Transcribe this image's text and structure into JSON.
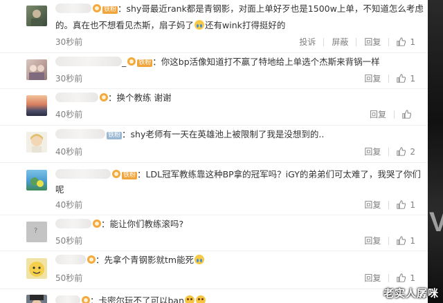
{
  "comments": [
    {
      "badge": "铁粉",
      "text_line1": "：shy哥最近rank都是青钢影，对面上单好歹也是1500w上单，不知道怎么考虑",
      "text_line2a": "的。真在也不想看见杰斯，扇子妈了",
      "text_line2b": "还有wink打得挺好的",
      "time": "30秒前",
      "report": "投诉",
      "block": "屏蔽",
      "reply": "回复",
      "likes": "1"
    },
    {
      "prefix": "_",
      "badge": "铁粉",
      "text": "：你这bp活像知道打不赢了特地给上单选个杰斯来背锅一样",
      "time": "30秒前",
      "reply": "回复",
      "likes": "1"
    },
    {
      "text": "：换个教练 谢谢",
      "time": "40秒前",
      "reply": "回复",
      "likes": ""
    },
    {
      "badge": "铁粉",
      "text": "：shy老师有一天在英雄池上被限制了我是没想到的..",
      "time": "40秒前",
      "reply": "回复",
      "likes": "2"
    },
    {
      "badge": "铁粉",
      "text_line1": "：LDL冠军教练靠这种BP拿的冠军吗？iGY的弟弟们可太难了，我哭了你们",
      "text_line2": "呢",
      "time": "40秒前",
      "reply": "回复",
      "likes": "1"
    },
    {
      "text": "：能让你们教练滚吗?",
      "time": "50秒前",
      "reply": "回复",
      "likes": "1"
    },
    {
      "text": "：先拿个青钢影就tm能死",
      "time": "50秒前",
      "reply": "回复",
      "likes": "1"
    },
    {
      "text": "：卡密尔玩不了可以ban"
    }
  ],
  "watermark": "老实人孱咪",
  "colors": {
    "badge_orange": "#f0a43b",
    "badge_iron": "#9bb8d3",
    "meta_gray": "#808080",
    "text": "#333333"
  }
}
